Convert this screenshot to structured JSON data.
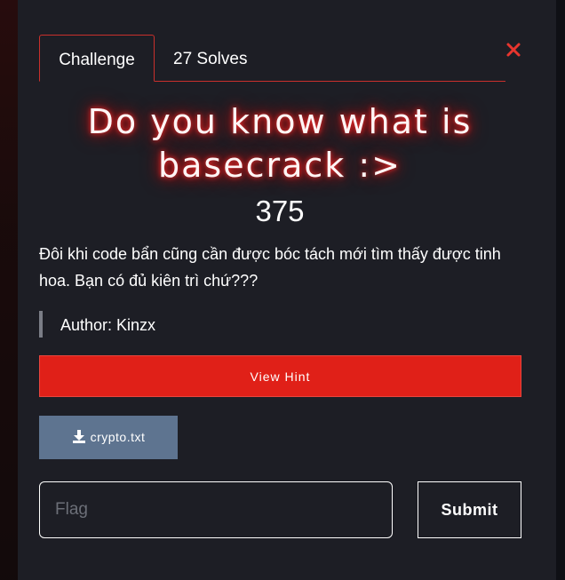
{
  "tabs": [
    {
      "label": "Challenge",
      "active": true
    },
    {
      "label": "27 Solves",
      "active": false
    }
  ],
  "challenge": {
    "title": "Do you know what is basecrack :>",
    "points": "375",
    "description": "Đôi khi code bẩn cũng cần được bóc tách mới tìm thấy được tinh hoa. Bạn có đủ kiên trì chứ???",
    "author": "Author: Kinzx"
  },
  "hint": {
    "label": "View Hint"
  },
  "file": {
    "name": "crypto.txt",
    "icon": "download-icon"
  },
  "flag": {
    "placeholder": "Flag",
    "value": ""
  },
  "submit": {
    "label": "Submit"
  },
  "close": {
    "icon": "close-icon"
  },
  "colors": {
    "accent": "#e02018",
    "tab_border": "#c9302c",
    "modal_bg": "#1d1e25",
    "file_button": "#5e7490",
    "title_glow": "#ff3030"
  }
}
